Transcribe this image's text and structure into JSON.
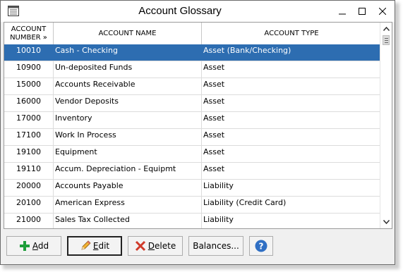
{
  "window": {
    "title": "Account Glossary",
    "controls": [
      "minimize-icon",
      "maximize-icon",
      "close-icon"
    ],
    "app_icon": "ledger-icon"
  },
  "table": {
    "columns": [
      {
        "line1": "ACCOUNT",
        "line2": "NUMBER »"
      },
      {
        "line1": "ACCOUNT NAME",
        "line2": ""
      },
      {
        "line1": "ACCOUNT TYPE",
        "line2": ""
      }
    ],
    "rows": [
      {
        "number": "10010",
        "name": "Cash - Checking",
        "type": "Asset (Bank/Checking)",
        "selected": true
      },
      {
        "number": "10900",
        "name": "Un-deposited Funds",
        "type": "Asset"
      },
      {
        "number": "15000",
        "name": "Accounts Receivable",
        "type": "Asset"
      },
      {
        "number": "16000",
        "name": "Vendor Deposits",
        "type": "Asset"
      },
      {
        "number": "17000",
        "name": "Inventory",
        "type": "Asset"
      },
      {
        "number": "17100",
        "name": "Work In Process",
        "type": "Asset"
      },
      {
        "number": "19100",
        "name": "Equipment",
        "type": "Asset"
      },
      {
        "number": "19110",
        "name": "Accum. Depreciation - Equipmt",
        "type": "Asset"
      },
      {
        "number": "20000",
        "name": "Accounts Payable",
        "type": "Liability"
      },
      {
        "number": "20100",
        "name": "American Express",
        "type": "Liability (Credit Card)"
      },
      {
        "number": "21000",
        "name": "Sales Tax Collected",
        "type": "Liability"
      }
    ]
  },
  "toolbar": {
    "add": {
      "label_underline": "A",
      "label_rest": "dd",
      "icon": "plus-icon"
    },
    "edit": {
      "label_underline": "E",
      "label_rest": "dit",
      "icon": "pencil-icon"
    },
    "delete": {
      "label_underline": "D",
      "label_rest": "elete",
      "icon": "x-icon"
    },
    "balances": {
      "label": "Balances..."
    },
    "help": {
      "label": "?",
      "icon": "help-icon"
    }
  },
  "colors": {
    "selection": "#2d6db1",
    "add_icon": "#1e9e3a",
    "delete_icon": "#d03a2a",
    "help_icon": "#2f6fc4"
  }
}
